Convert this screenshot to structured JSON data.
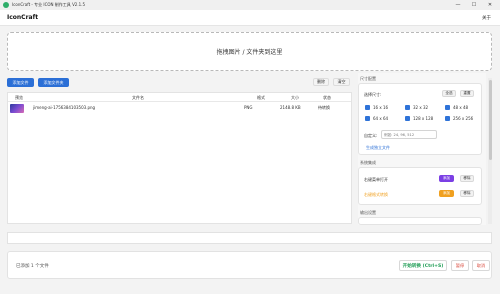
{
  "window": {
    "title": "IconCraft - 专业 ICON 制作工具 V2.1.5",
    "controls": [
      "—",
      "☐",
      "✕"
    ]
  },
  "appbar": {
    "name": "IconCraft",
    "about": "关于"
  },
  "dropzone": {
    "text": "拖拽图片 / 文件夹到这里"
  },
  "toolbar": {
    "add_file": "添加文件",
    "add_folder": "添加文件夹",
    "remove": "删除",
    "clear": "清空"
  },
  "table": {
    "columns": [
      "预览",
      "文件名",
      "格式",
      "大小",
      "状态"
    ],
    "rows": [
      {
        "filename": "jimeng-ai-1756384103503.png",
        "format": "PNG",
        "size": "2148.8 KB",
        "status": "待转换"
      }
    ]
  },
  "sizes": {
    "title": "尺寸配置",
    "label": "选择尺寸:",
    "select_all": "全选",
    "reset": "重置",
    "options": [
      "16 x 16",
      "32 x 32",
      "48 x 48",
      "64 x 64",
      "128 x 128",
      "256 x 256"
    ],
    "custom_label": "自定义:",
    "custom_placeholder": "例如: 24, 96, 512",
    "single_file": "生成独立文件"
  },
  "integration": {
    "title": "系统集成",
    "open_menu": "右键菜单打开",
    "convert_menu": "右键格式转换",
    "add": "添加",
    "remove": "移除"
  },
  "output": {
    "title": "输出设置"
  },
  "status": {
    "text": "已添加 1 个文件",
    "start": "开始转换 (Ctrl+S)",
    "pause": "暂停",
    "cancel": "取消"
  },
  "colors": {
    "primary": "#2b6fd6",
    "green": "#1f9d55",
    "purple": "#7b3fe4",
    "orange": "#f0a020",
    "red": "#d9473a"
  }
}
